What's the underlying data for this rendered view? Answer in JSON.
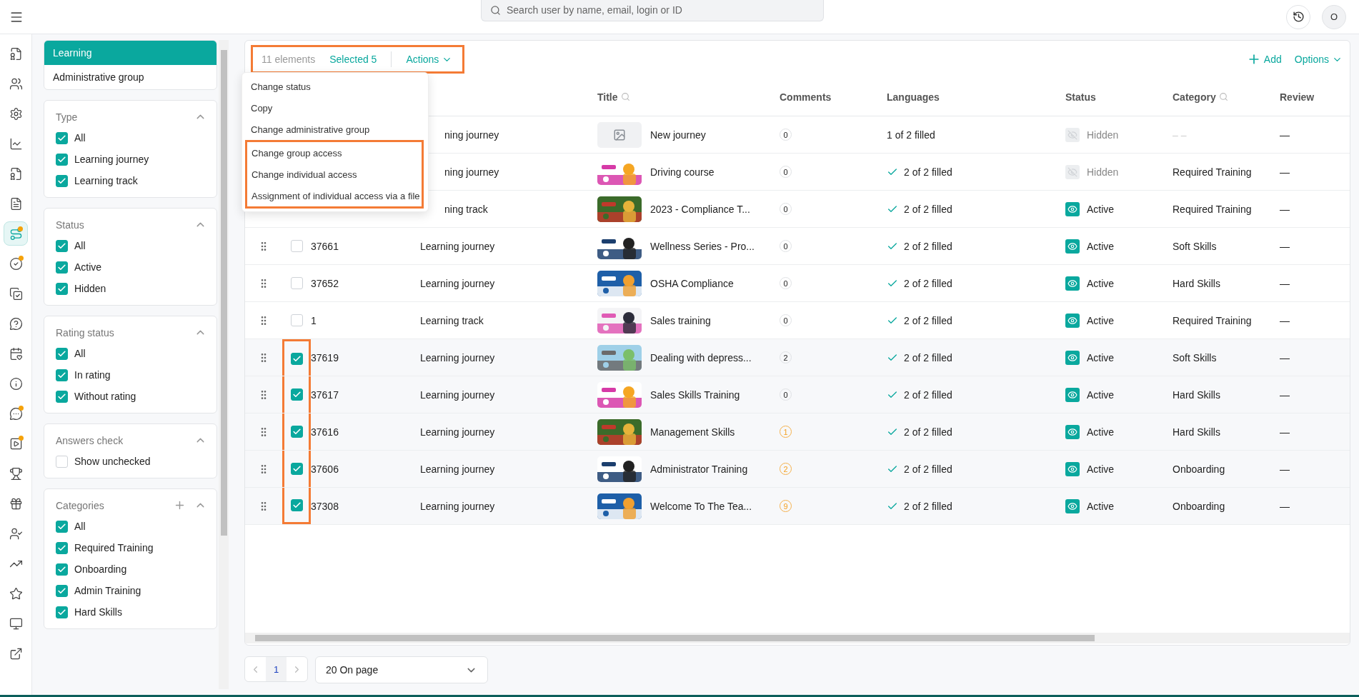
{
  "topbar": {
    "search_placeholder": "Search user by name, email, login or ID",
    "avatar": "O"
  },
  "nav": [
    {
      "selected": false,
      "dot": false
    },
    {
      "selected": false,
      "dot": false
    },
    {
      "selected": false,
      "dot": false
    },
    {
      "selected": false,
      "dot": false
    },
    {
      "selected": false,
      "dot": false
    },
    {
      "selected": false,
      "dot": false
    },
    {
      "selected": true,
      "dot": true
    },
    {
      "selected": false,
      "dot": true
    },
    {
      "selected": false,
      "dot": false
    },
    {
      "selected": false,
      "dot": false
    },
    {
      "selected": false,
      "dot": false
    },
    {
      "selected": false,
      "dot": false
    },
    {
      "selected": false,
      "dot": true
    },
    {
      "selected": false,
      "dot": true
    },
    {
      "selected": false,
      "dot": false
    },
    {
      "selected": false,
      "dot": false
    },
    {
      "selected": false,
      "dot": false
    },
    {
      "selected": false,
      "dot": false
    },
    {
      "selected": false,
      "dot": false
    },
    {
      "selected": false,
      "dot": false
    },
    {
      "selected": false,
      "dot": false
    }
  ],
  "filter_tabs": [
    {
      "label": "Learning",
      "selected": true
    },
    {
      "label": "Administrative group",
      "selected": false
    }
  ],
  "filters": [
    {
      "title": "Type",
      "expanded": true,
      "addable": false,
      "options": [
        {
          "label": "All",
          "checked": true
        },
        {
          "label": "Learning journey",
          "checked": true
        },
        {
          "label": "Learning track",
          "checked": true
        }
      ]
    },
    {
      "title": "Status",
      "expanded": true,
      "addable": false,
      "options": [
        {
          "label": "All",
          "checked": true
        },
        {
          "label": "Active",
          "checked": true
        },
        {
          "label": "Hidden",
          "checked": true
        }
      ]
    },
    {
      "title": "Rating status",
      "expanded": true,
      "addable": false,
      "options": [
        {
          "label": "All",
          "checked": true
        },
        {
          "label": "In rating",
          "checked": true
        },
        {
          "label": "Without rating",
          "checked": true
        }
      ]
    },
    {
      "title": "Answers check",
      "expanded": true,
      "addable": false,
      "options": [
        {
          "label": "Show unchecked",
          "checked": false
        }
      ]
    },
    {
      "title": "Categories",
      "expanded": true,
      "addable": true,
      "options": [
        {
          "label": "All",
          "checked": true
        },
        {
          "label": "Required Training",
          "checked": true
        },
        {
          "label": "Onboarding",
          "checked": true
        },
        {
          "label": "Admin Training",
          "checked": true
        },
        {
          "label": "Hard Skills",
          "checked": true
        }
      ]
    }
  ],
  "toolbar": {
    "count": "11 elements",
    "selected": "Selected 5",
    "actions": "Actions",
    "highlighted": true,
    "add": "Add",
    "options": "Options"
  },
  "actions_menu": [
    {
      "label": "Change status",
      "highlighted": false
    },
    {
      "label": "Copy",
      "highlighted": false
    },
    {
      "label": "Change administrative group",
      "highlighted": false
    },
    {
      "label": "Change group access",
      "highlighted": true
    },
    {
      "label": "Change individual access",
      "highlighted": true
    },
    {
      "label": "Assignment of individual access via a file",
      "highlighted": true
    }
  ],
  "table": {
    "columns": [
      {
        "label": "Title",
        "searchable": true
      },
      {
        "label": "Comments",
        "searchable": false
      },
      {
        "label": "Languages",
        "searchable": false
      },
      {
        "label": "Status",
        "searchable": false
      },
      {
        "label": "Category",
        "searchable": true
      },
      {
        "label": "Review",
        "searchable": false
      }
    ],
    "checked_highlighted": true,
    "rows": [
      {
        "covered": true,
        "type": "ning journey",
        "thumbnail": {
          "kind": "placeholder"
        },
        "title": "New journey",
        "comments": "0",
        "new_comments": false,
        "languages": "1 of 2 filled",
        "complete": false,
        "status": "Hidden",
        "active": false,
        "category": "– –",
        "category_empty": true,
        "review": "—"
      },
      {
        "covered": true,
        "type": "ning journey",
        "title": "Driving course",
        "comments": "0",
        "new_comments": false,
        "languages": "2 of 2 filled",
        "complete": true,
        "status": "Hidden",
        "active": false,
        "category": "Required Training",
        "category_empty": false,
        "review": "—"
      },
      {
        "covered": true,
        "type": "ning track",
        "title": "2023 - Compliance T...",
        "comments": "0",
        "new_comments": false,
        "languages": "2 of 2 filled",
        "complete": true,
        "status": "Active",
        "active": true,
        "category": "Required Training",
        "category_empty": false,
        "review": "—"
      },
      {
        "covered": false,
        "checked": false,
        "id": "37661",
        "type": "Learning journey",
        "title": "Wellness Series - Pro...",
        "comments": "0",
        "new_comments": false,
        "languages": "2 of 2 filled",
        "complete": true,
        "status": "Active",
        "active": true,
        "category": "Soft Skills",
        "category_empty": false,
        "review": "—"
      },
      {
        "covered": false,
        "checked": false,
        "id": "37652",
        "type": "Learning journey",
        "title": "OSHA Compliance",
        "comments": "0",
        "new_comments": false,
        "languages": "2 of 2 filled",
        "complete": true,
        "status": "Active",
        "active": true,
        "category": "Hard Skills",
        "category_empty": false,
        "review": "—"
      },
      {
        "covered": false,
        "checked": false,
        "id": "1",
        "type": "Learning track",
        "title": "Sales training",
        "comments": "0",
        "new_comments": false,
        "languages": "2 of 2 filled",
        "complete": true,
        "status": "Active",
        "active": true,
        "category": "Required Training",
        "category_empty": false,
        "review": "—"
      },
      {
        "covered": false,
        "checked": true,
        "id": "37619",
        "type": "Learning journey",
        "title": "Dealing with depress...",
        "comments": "2",
        "new_comments": false,
        "languages": "2 of 2 filled",
        "complete": true,
        "status": "Active",
        "active": true,
        "category": "Soft Skills",
        "category_empty": false,
        "review": "—"
      },
      {
        "covered": false,
        "checked": true,
        "id": "37617",
        "type": "Learning journey",
        "title": "Sales Skills Training",
        "comments": "0",
        "new_comments": false,
        "languages": "2 of 2 filled",
        "complete": true,
        "status": "Active",
        "active": true,
        "category": "Hard Skills",
        "category_empty": false,
        "review": "—"
      },
      {
        "covered": false,
        "checked": true,
        "id": "37616",
        "type": "Learning journey",
        "title": "Management Skills",
        "comments": "1",
        "new_comments": true,
        "languages": "2 of 2 filled",
        "complete": true,
        "status": "Active",
        "active": true,
        "category": "Hard Skills",
        "category_empty": false,
        "review": "—"
      },
      {
        "covered": false,
        "checked": true,
        "id": "37606",
        "type": "Learning journey",
        "title": "Administrator Training",
        "comments": "2",
        "new_comments": true,
        "languages": "2 of 2 filled",
        "complete": true,
        "status": "Active",
        "active": true,
        "category": "Onboarding",
        "category_empty": false,
        "review": "—"
      },
      {
        "covered": false,
        "checked": true,
        "id": "37308",
        "type": "Learning journey",
        "title": "Welcome To The Tea...",
        "comments": "9",
        "new_comments": true,
        "languages": "2 of 2 filled",
        "complete": true,
        "status": "Active",
        "active": true,
        "category": "Onboarding",
        "category_empty": false,
        "review": "—"
      }
    ]
  },
  "pagination": {
    "page": "1",
    "page_size": "20 On page"
  }
}
